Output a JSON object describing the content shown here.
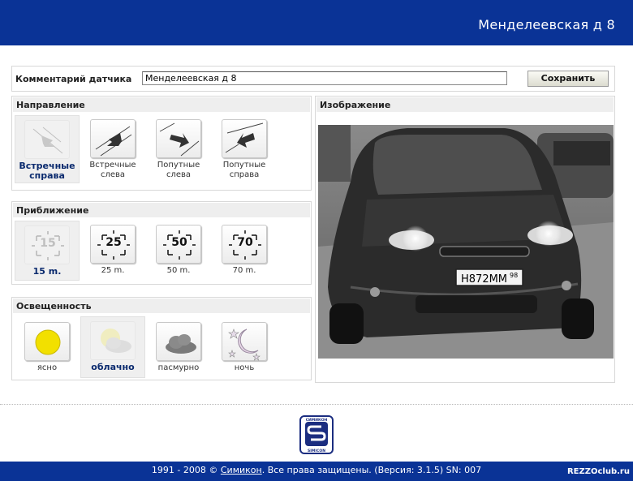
{
  "header": {
    "title": "Менделеевская д 8"
  },
  "comment": {
    "label": "Комментарий датчика",
    "value": "Менделеевская д 8",
    "save_label": "Сохранить"
  },
  "direction": {
    "title": "Направление",
    "options": [
      {
        "label1": "Встречные",
        "label2": "справа",
        "selected": true
      },
      {
        "label1": "Встречные",
        "label2": "слева",
        "selected": false
      },
      {
        "label1": "Попутные",
        "label2": "слева",
        "selected": false
      },
      {
        "label1": "Попутные",
        "label2": "справа",
        "selected": false
      }
    ]
  },
  "approach": {
    "title": "Приближение",
    "options": [
      {
        "value": "15",
        "label": "15 m.",
        "selected": true
      },
      {
        "value": "25",
        "label": "25 m.",
        "selected": false
      },
      {
        "value": "50",
        "label": "50 m.",
        "selected": false
      },
      {
        "value": "70",
        "label": "70 m.",
        "selected": false
      }
    ]
  },
  "lighting": {
    "title": "Освещенность",
    "options": [
      {
        "label": "ясно",
        "icon": "sun-icon",
        "selected": false
      },
      {
        "label": "облачно",
        "icon": "cloud-sun-icon",
        "selected": true
      },
      {
        "label": "пасмурно",
        "icon": "cloud-icon",
        "selected": false
      },
      {
        "label": "ночь",
        "icon": "moon-icon",
        "selected": false
      }
    ]
  },
  "image": {
    "title": "Изображение",
    "plate_number": "Н872ММ",
    "plate_region": "98"
  },
  "footer": {
    "prefix": "1991 - 2008 © ",
    "link": "Симикон",
    "suffix": ". Все права защищены. (Версия: 3.1.5) SN: 007",
    "watermark": "REZZOclub.ru",
    "logo_top": "СИМИКОН",
    "logo_bottom": "SIMICON"
  },
  "colors": {
    "brand": "#0a3396",
    "selected_text": "#0a2a6e",
    "panel_header": "#eeeeee"
  }
}
